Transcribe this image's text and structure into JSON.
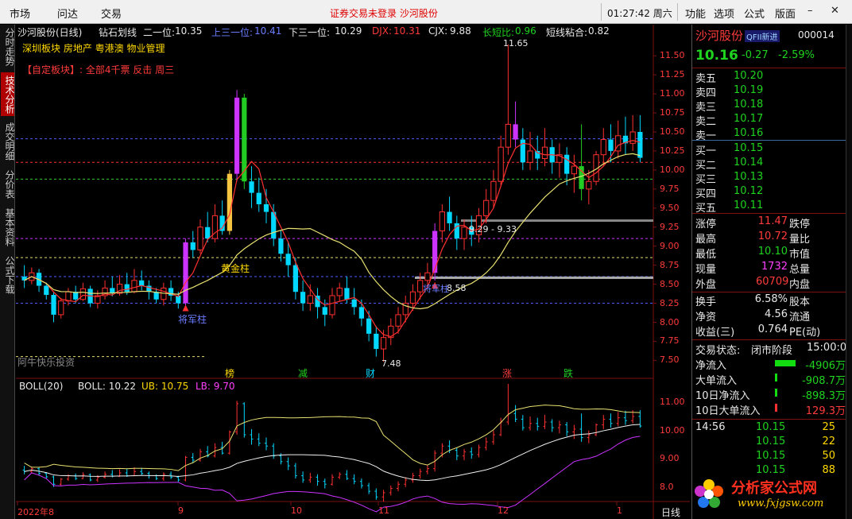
{
  "menu": {
    "market": "市场",
    "ask": "问达",
    "trade": "交易",
    "notice": "证券交易未登录  沙河股份",
    "clock": "01:27:42 周六",
    "function": "功能",
    "options": "选项",
    "formula": "公式",
    "layout": "版面"
  },
  "lefttabs": [
    "分时走势",
    "技术分析",
    "成交明细",
    "分价表",
    "基本资料",
    "公式下载"
  ],
  "header": {
    "title": "沙河股份(日线)",
    "indicator": "钻石划线",
    "line2_label": "二一位:",
    "line2_value": "10.35",
    "line3_label": "上三一位:",
    "line3_value": "10.41",
    "line4_label": "下三一位:",
    "line4_value": "10.29",
    "djx_label": "DJX:",
    "djx_value": "10.31",
    "cjx_label": "CJX:",
    "cjx_value": "9.88",
    "cdb_label": "长短比:",
    "cdb_value": "0.96",
    "dxzh_label": "短线粘合:",
    "dxzh_value": "0.82",
    "sectors": "深圳板块 房地产 粤港澳 物业管理",
    "custom": "【自定板块】: 全部4千票 反击 周三"
  },
  "annotations": {
    "high": "11.65",
    "low": "7.48",
    "range": "9.29 - 9.33",
    "price858": "8.58",
    "golden": "黄金柱",
    "general": "将军柱",
    "general2": "将军柱",
    "watermark_left": "阿牛快乐投资",
    "events": [
      "榜",
      "减",
      "财",
      "涨",
      "跌"
    ]
  },
  "boll": {
    "label": "BOLL(20)",
    "boll": "BOLL: 10.22",
    "ub": "UB: 10.75",
    "lb": "LB: 9.70"
  },
  "xaxis": [
    "2022年8",
    "9",
    "10",
    "11",
    "12",
    "1"
  ],
  "period": "日线",
  "price_axis": [
    "11.50",
    "11.25",
    "11.00",
    "10.75",
    "10.50",
    "10.25",
    "10.00",
    "9.75",
    "9.50",
    "9.25",
    "9.00",
    "8.75",
    "8.50",
    "8.25",
    "8.00",
    "7.75",
    "7.50"
  ],
  "boll_axis": [
    "11.00",
    "10.00",
    "9.00",
    "8.0"
  ],
  "quote": {
    "name": "沙河股份",
    "tag": "QFII新进",
    "code": "000014",
    "price": "10.16",
    "change": "-0.27",
    "pct": "-2.59%",
    "asks": [
      {
        "l": "卖五",
        "p": "10.20"
      },
      {
        "l": "卖四",
        "p": "10.19"
      },
      {
        "l": "卖三",
        "p": "10.18"
      },
      {
        "l": "卖二",
        "p": "10.17"
      },
      {
        "l": "卖一",
        "p": "10.16"
      }
    ],
    "bids": [
      {
        "l": "买一",
        "p": "10.15"
      },
      {
        "l": "买二",
        "p": "10.14"
      },
      {
        "l": "买三",
        "p": "10.13"
      },
      {
        "l": "买四",
        "p": "10.12"
      },
      {
        "l": "买五",
        "p": "10.11"
      }
    ],
    "stats": [
      {
        "l": "涨停",
        "v": "11.47",
        "c": "red",
        "r": "跌停"
      },
      {
        "l": "最高",
        "v": "10.72",
        "c": "red",
        "r": "量比"
      },
      {
        "l": "最低",
        "v": "10.10",
        "c": "green",
        "r": "市值"
      },
      {
        "l": "现量",
        "v": "1732",
        "c": "magenta",
        "r": "总量"
      },
      {
        "l": "外盘",
        "v": "60709",
        "c": "red",
        "r": "内盘"
      }
    ],
    "stats2": [
      {
        "l": "换手",
        "v": "6.58%",
        "r": "股本"
      },
      {
        "l": "净资",
        "v": "4.56",
        "r": "流通"
      },
      {
        "l": "收益(三)",
        "v": "0.764",
        "r": "PE(动)"
      }
    ],
    "trade_state_label": "交易状态:",
    "trade_state": "闭市阶段",
    "trade_time": "15:00:0",
    "flows": [
      {
        "l": "净流入",
        "v": "-4906万",
        "c": "green"
      },
      {
        "l": "大单流入",
        "v": "-908.7万",
        "c": "green"
      },
      {
        "l": "10日净流入",
        "v": "-898.3万",
        "c": "green"
      },
      {
        "l": "10日大单流入",
        "v": "129.3万",
        "c": "red"
      }
    ],
    "ticks": [
      {
        "t": "14:56",
        "p": "10.15",
        "v": "25"
      },
      {
        "t": "",
        "p": "10.15",
        "v": "22"
      },
      {
        "t": "",
        "p": "10.15",
        "v": "50"
      },
      {
        "t": "",
        "p": "10.15",
        "v": "88"
      }
    ]
  },
  "watermark": {
    "brand": "分析家公式网",
    "url": "www.fxjgsw.com"
  },
  "colors": {
    "up": "#ff3030",
    "down": "#00d8ff",
    "ma": "#e8e070",
    "purple": "#cc33ff",
    "green": "#22cc22"
  },
  "chart_data": {
    "type": "candlestick",
    "price_range": [
      7.4,
      11.7
    ],
    "x_ticks": [
      "2022年8",
      "9",
      "10",
      "11",
      "12",
      "1"
    ],
    "candles": [
      [
        8.6,
        8.55,
        8.75,
        8.45
      ],
      [
        8.55,
        8.65,
        8.72,
        8.5
      ],
      [
        8.65,
        8.48,
        8.7,
        8.4
      ],
      [
        8.48,
        8.36,
        8.52,
        8.3
      ],
      [
        8.36,
        8.1,
        8.4,
        8.0
      ],
      [
        8.1,
        8.28,
        8.32,
        8.05
      ],
      [
        8.28,
        8.4,
        8.45,
        8.22
      ],
      [
        8.4,
        8.3,
        8.48,
        8.25
      ],
      [
        8.3,
        8.44,
        8.52,
        8.28
      ],
      [
        8.44,
        8.25,
        8.48,
        8.2
      ],
      [
        8.25,
        8.35,
        8.42,
        8.18
      ],
      [
        8.35,
        8.45,
        8.55,
        8.3
      ],
      [
        8.45,
        8.38,
        8.6,
        8.34
      ],
      [
        8.38,
        8.5,
        8.62,
        8.35
      ],
      [
        8.5,
        8.4,
        8.65,
        8.36
      ],
      [
        8.4,
        8.55,
        8.7,
        8.38
      ],
      [
        8.55,
        8.48,
        8.68,
        8.42
      ],
      [
        8.48,
        8.4,
        8.55,
        8.3
      ],
      [
        8.4,
        8.3,
        8.45,
        8.25
      ],
      [
        8.3,
        8.45,
        8.52,
        8.22
      ],
      [
        8.45,
        8.35,
        8.55,
        8.28
      ],
      [
        8.35,
        8.25,
        8.4,
        8.18
      ],
      [
        8.25,
        9.05,
        9.1,
        8.2
      ],
      [
        9.05,
        8.95,
        9.2,
        8.85
      ],
      [
        8.95,
        9.25,
        9.35,
        8.9
      ],
      [
        9.25,
        9.1,
        9.45,
        9.05
      ],
      [
        9.1,
        9.4,
        9.55,
        9.05
      ],
      [
        9.4,
        9.2,
        9.6,
        9.15
      ],
      [
        9.2,
        9.95,
        10.0,
        9.15
      ],
      [
        9.95,
        10.95,
        11.05,
        9.85
      ],
      [
        10.95,
        9.85,
        11.0,
        9.75
      ],
      [
        9.85,
        9.7,
        10.05,
        9.5
      ],
      [
        9.7,
        9.55,
        9.9,
        9.45
      ],
      [
        9.55,
        9.45,
        9.75,
        9.3
      ],
      [
        9.45,
        9.1,
        9.55,
        9.0
      ],
      [
        9.1,
        8.9,
        9.2,
        8.8
      ],
      [
        8.9,
        8.75,
        9.05,
        8.6
      ],
      [
        8.75,
        8.4,
        8.85,
        8.3
      ],
      [
        8.4,
        8.25,
        8.55,
        8.15
      ],
      [
        8.25,
        8.35,
        8.5,
        8.15
      ],
      [
        8.35,
        8.2,
        8.45,
        8.05
      ],
      [
        8.2,
        8.1,
        8.3,
        7.95
      ],
      [
        8.1,
        8.35,
        8.45,
        8.05
      ],
      [
        8.35,
        8.45,
        8.52,
        8.28
      ],
      [
        8.45,
        8.3,
        8.6,
        8.25
      ],
      [
        8.3,
        8.2,
        8.45,
        8.1
      ],
      [
        8.2,
        8.05,
        8.3,
        7.95
      ],
      [
        8.05,
        7.85,
        8.15,
        7.75
      ],
      [
        7.85,
        7.65,
        7.95,
        7.55
      ],
      [
        7.65,
        7.8,
        7.9,
        7.48
      ],
      [
        7.8,
        7.95,
        8.05,
        7.7
      ],
      [
        7.95,
        8.1,
        8.2,
        7.85
      ],
      [
        8.1,
        8.25,
        8.35,
        8.0
      ],
      [
        8.25,
        8.4,
        8.5,
        8.15
      ],
      [
        8.4,
        8.55,
        8.65,
        8.3
      ],
      [
        8.55,
        8.65,
        8.78,
        8.45
      ],
      [
        8.65,
        9.2,
        9.3,
        8.55
      ],
      [
        9.2,
        9.45,
        9.55,
        9.05
      ],
      [
        9.45,
        9.3,
        9.65,
        9.2
      ],
      [
        9.3,
        9.1,
        9.4,
        8.95
      ],
      [
        9.1,
        9.25,
        9.35,
        8.95
      ],
      [
        9.25,
        9.15,
        9.4,
        9.0
      ],
      [
        9.15,
        9.4,
        9.5,
        9.05
      ],
      [
        9.4,
        9.6,
        9.75,
        9.3
      ],
      [
        9.6,
        9.85,
        10.0,
        9.5
      ],
      [
        9.85,
        10.3,
        10.45,
        9.8
      ],
      [
        10.3,
        10.6,
        11.65,
        10.2
      ],
      [
        10.6,
        10.4,
        10.9,
        10.3
      ],
      [
        10.4,
        10.1,
        10.55,
        10.0
      ],
      [
        10.1,
        10.25,
        10.5,
        10.0
      ],
      [
        10.25,
        10.15,
        10.45,
        10.0
      ],
      [
        10.15,
        10.3,
        10.55,
        10.05
      ],
      [
        10.3,
        10.1,
        10.4,
        9.95
      ],
      [
        10.1,
        10.2,
        10.35,
        9.9
      ],
      [
        10.2,
        9.95,
        10.3,
        9.8
      ],
      [
        9.95,
        10.05,
        10.2,
        9.7
      ],
      [
        10.05,
        9.75,
        10.6,
        9.6
      ],
      [
        9.75,
        9.85,
        10.0,
        9.55
      ],
      [
        9.85,
        10.2,
        10.25,
        9.8
      ],
      [
        10.2,
        10.4,
        10.55,
        10.05
      ],
      [
        10.4,
        10.25,
        10.6,
        10.1
      ],
      [
        10.25,
        10.45,
        10.65,
        10.15
      ],
      [
        10.45,
        10.35,
        10.7,
        10.2
      ],
      [
        10.35,
        10.5,
        10.72,
        10.25
      ],
      [
        10.5,
        10.16,
        10.72,
        10.1
      ]
    ],
    "boll": {
      "mid": 10.22,
      "upper": 10.75,
      "lower": 9.7
    }
  }
}
